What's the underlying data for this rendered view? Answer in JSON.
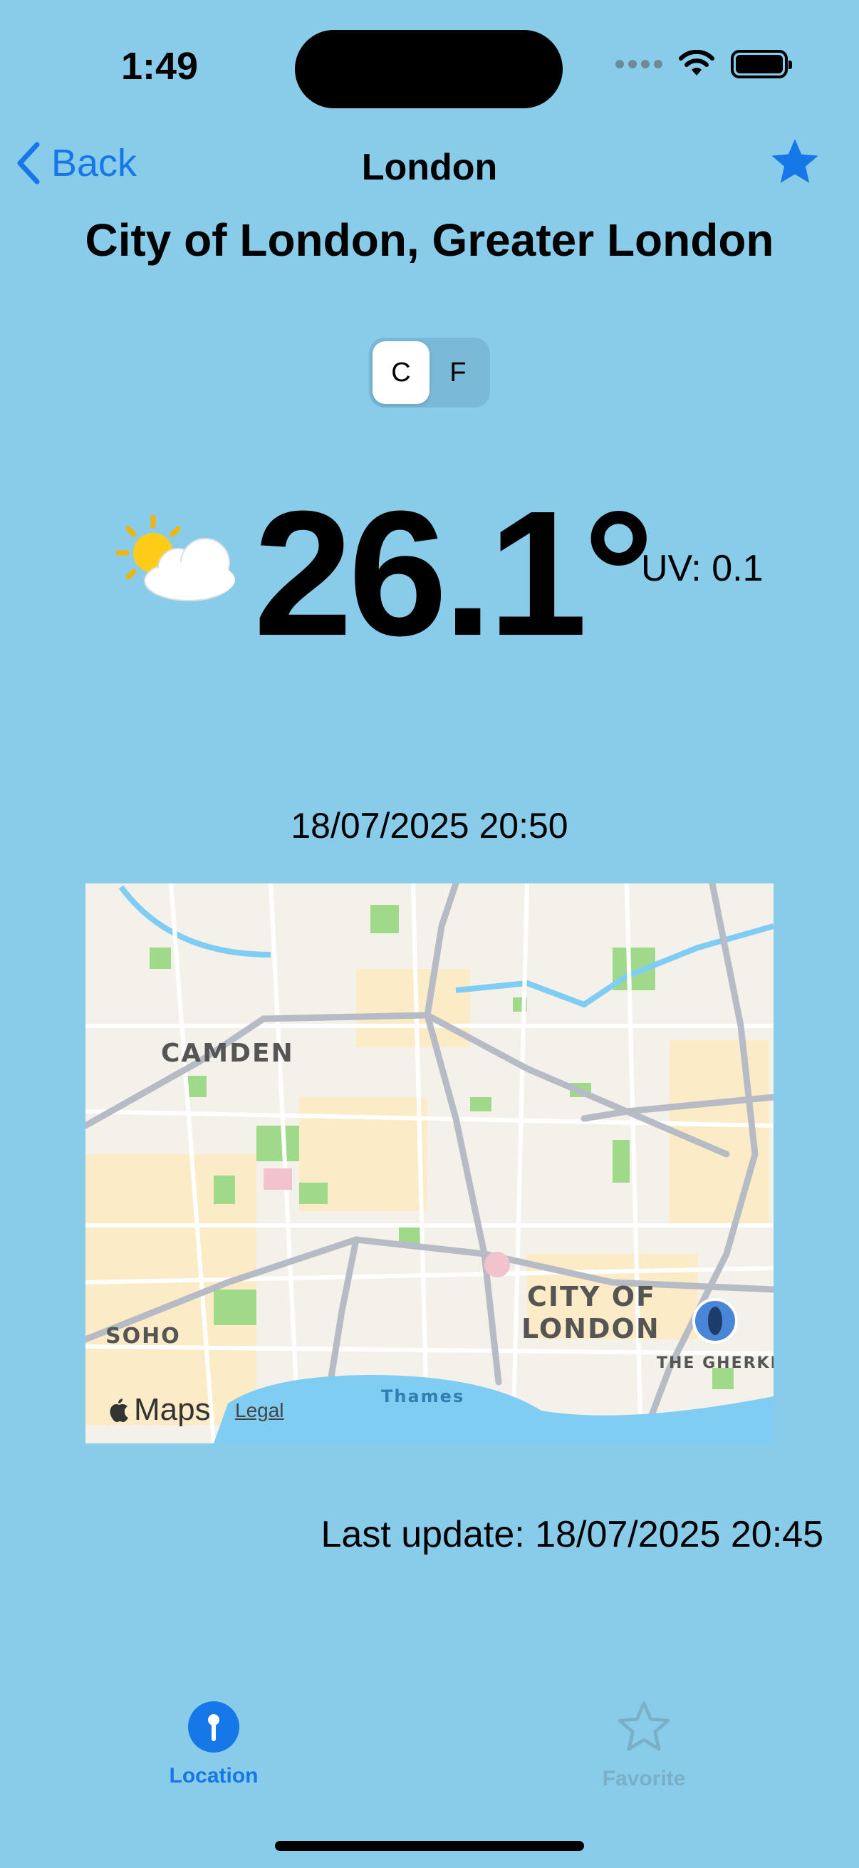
{
  "status_bar": {
    "time": "1:49"
  },
  "nav": {
    "back_label": "Back",
    "title": "London"
  },
  "location": {
    "subtitle": "City of London, Greater London"
  },
  "units": {
    "options": [
      "C",
      "F"
    ],
    "selected": "C"
  },
  "weather": {
    "icon": "partly-cloudy-icon",
    "temperature": "26.1°",
    "uv": "UV: 0.1",
    "time": "18/07/2025 20:50"
  },
  "map": {
    "labels": {
      "camden": "CAMDEN",
      "city_of": "CITY OF",
      "london": "LONDON",
      "soho": "SOHO",
      "gherkin": "THE GHERKIN",
      "thames": "Thames"
    },
    "brand": "Maps",
    "legal": "Legal"
  },
  "last_update": "Last update: 18/07/2025 20:45",
  "tabs": [
    {
      "label": "Location",
      "icon": "location-pin-icon",
      "active": true
    },
    {
      "label": "Favorite",
      "icon": "star-outline-icon",
      "active": false
    }
  ],
  "colors": {
    "background": "#88CCEA",
    "accent": "#1677E8",
    "inactive_tab": "#7AAFC8"
  }
}
